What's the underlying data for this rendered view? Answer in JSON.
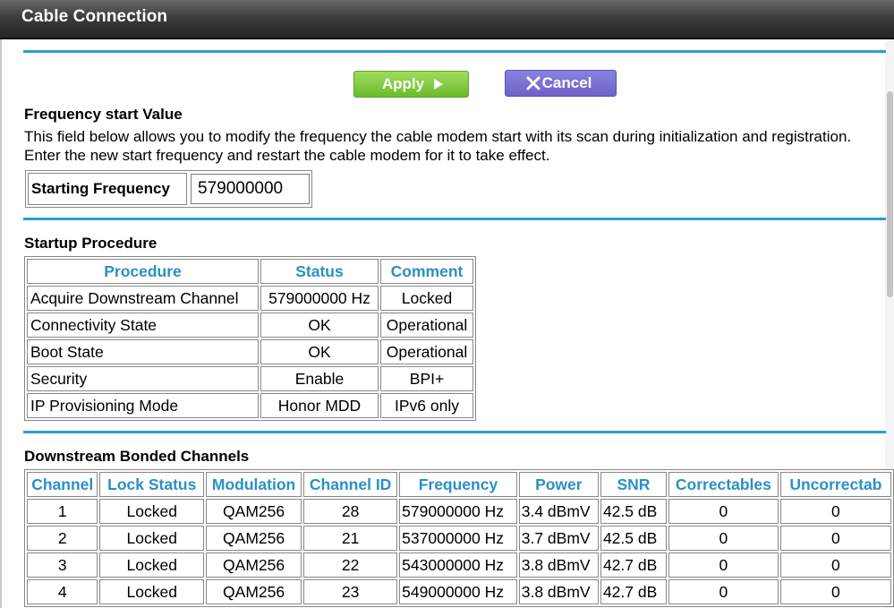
{
  "window": {
    "title": "Cable Connection"
  },
  "buttons": {
    "apply": "Apply",
    "cancel": "Cancel"
  },
  "frequency_section": {
    "title": "Frequency start Value",
    "description": "This field below allows you to modify the frequency the cable modem start with its scan during initialization and registration. Enter the new start frequency and restart the cable modem for it to take effect.",
    "field_label": "Starting Frequency",
    "field_value": "579000000"
  },
  "startup": {
    "title": "Startup Procedure",
    "headers": [
      "Procedure",
      "Status",
      "Comment"
    ],
    "rows": [
      [
        "Acquire Downstream Channel",
        "579000000 Hz",
        "Locked"
      ],
      [
        "Connectivity State",
        "OK",
        "Operational"
      ],
      [
        "Boot State",
        "OK",
        "Operational"
      ],
      [
        "Security",
        "Enable",
        "BPI+"
      ],
      [
        "IP Provisioning Mode",
        "Honor MDD",
        "IPv6 only"
      ]
    ]
  },
  "downstream": {
    "title": "Downstream Bonded Channels",
    "headers": [
      "Channel",
      "Lock Status",
      "Modulation",
      "Channel ID",
      "Frequency",
      "Power",
      "SNR",
      "Correctables",
      "Uncorrectab"
    ],
    "rows": [
      [
        "1",
        "Locked",
        "QAM256",
        "28",
        "579000000 Hz",
        "3.4 dBmV",
        "42.5 dB",
        "0",
        "0"
      ],
      [
        "2",
        "Locked",
        "QAM256",
        "21",
        "537000000 Hz",
        "3.7 dBmV",
        "42.5 dB",
        "0",
        "0"
      ],
      [
        "3",
        "Locked",
        "QAM256",
        "22",
        "543000000 Hz",
        "3.8 dBmV",
        "42.7 dB",
        "0",
        "0"
      ],
      [
        "4",
        "Locked",
        "QAM256",
        "23",
        "549000000 Hz",
        "3.8 dBmV",
        "42.7 dB",
        "0",
        "0"
      ]
    ]
  },
  "colors": {
    "accent": "#2f9bd2",
    "header_text": "#2b8fc8",
    "apply": "#7ac33b",
    "cancel": "#7a70d6"
  },
  "icons": {
    "apply": "play-arrow-icon",
    "cancel": "x-close-icon"
  }
}
